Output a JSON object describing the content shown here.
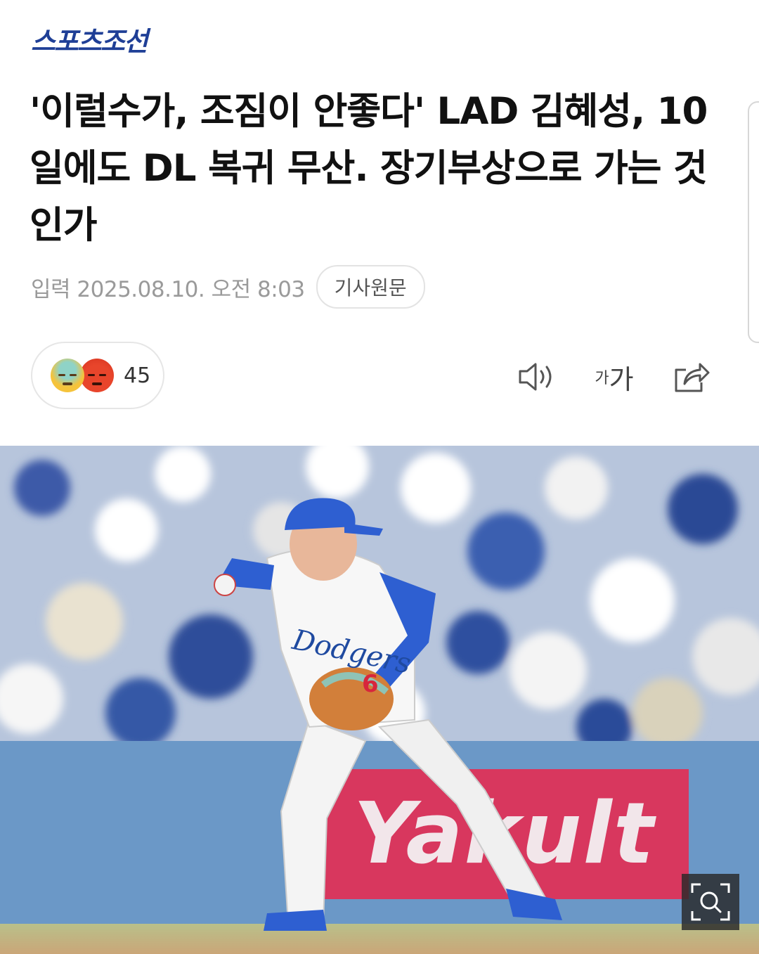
{
  "header": {
    "logo_text": "스포츠조선",
    "logo_color": "#1f3f96"
  },
  "article": {
    "title": "'이럴수가, 조짐이 안좋다' LAD 김혜성, 10일에도 DL 복귀 무산. 장기부상으로 가는 것인가",
    "published": "입력 2025.08.10. 오전 8:03",
    "source_button": "기사원문"
  },
  "reactions": {
    "emojis": [
      "sad-sweat-emoji",
      "angry-emoji"
    ],
    "count": "45"
  },
  "toolbar": {
    "tts_icon": "speaker-icon",
    "font_size_small": "가",
    "font_size_big": "가",
    "share_icon": "share-icon"
  },
  "photo": {
    "sign_text": "Yakult",
    "jersey_text": "Dodgers",
    "jersey_number": "6",
    "zoom_icon": "zoom-search-icon"
  },
  "colors": {
    "accent": "#1f3f96",
    "sign": "#d8375e",
    "wall": "#6b98c7"
  }
}
